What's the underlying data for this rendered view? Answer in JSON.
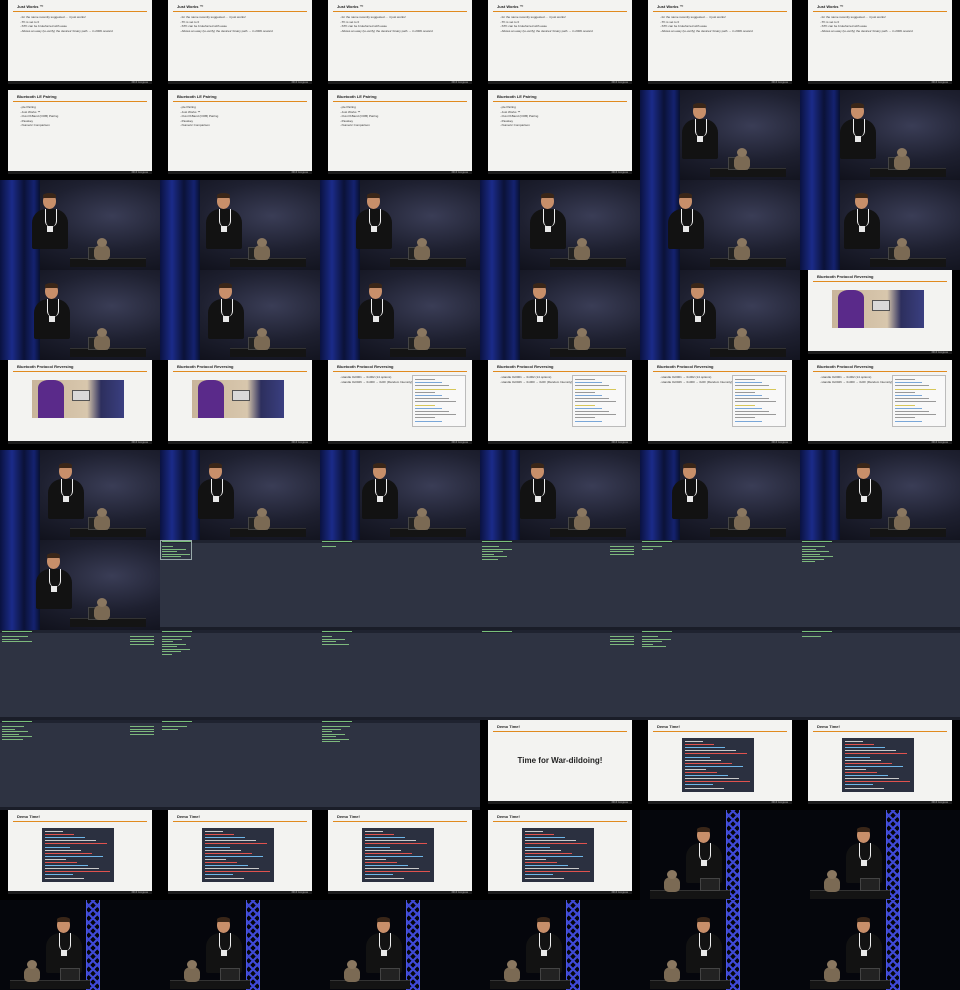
{
  "slide_footer_logo": "36C3 Congress",
  "slides": {
    "just_works": {
      "title": "Just Works ™",
      "bullets": [
        "for the name recently suggested … it just works!",
        "TK is set to 0",
        "STK can be bruteforced with ease",
        "Allows an easy (to-verify) the devices' binary path → in 2006 onward"
      ]
    },
    "le_pairing": {
      "title": "Bluetooth LE Pairing",
      "bullets": [
        "ple Pairing",
        "Just Works ™",
        "Out-Of-Band (OOB) Pairing",
        "Passkey",
        "Numeric Comparison"
      ]
    },
    "protocol_reversing": {
      "title": "Bluetooth Protocol Reversing"
    },
    "handles": {
      "title": "Bluetooth Protocol Reversing",
      "bullets": [
        "Handle 0x0001 → 0x002 (14 options)",
        "Handle 0x0026 → 0x000 → 0x0F (Random Intensity)"
      ]
    },
    "demo": {
      "title": "Demo Time!",
      "big": "Time for War-dildoing!"
    },
    "demo_term": {
      "title": "Demo Time!"
    }
  }
}
